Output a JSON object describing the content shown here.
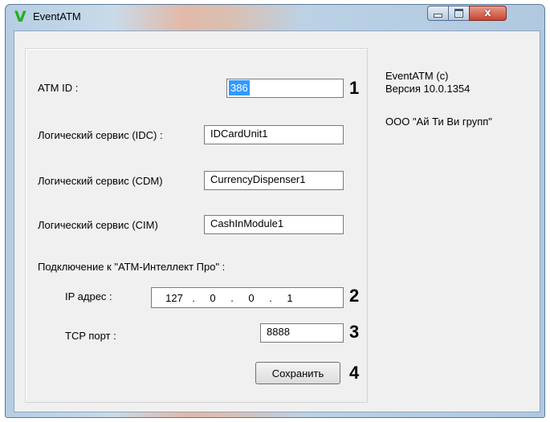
{
  "window": {
    "title": "EventATM",
    "app_icon_glyph": "V",
    "app_icon_color": "#1fb01f",
    "buttons": {
      "minimize": "minimize-icon",
      "maximize": "maximize-icon",
      "close": "close-icon",
      "close_glyph": "x"
    }
  },
  "form": {
    "atm_id_label": "ATM ID :",
    "atm_id_value": "386",
    "idc_label": "Логический сервис (IDC) :",
    "idc_value": "IDCardUnit1",
    "cdm_label": "Логический сервис (CDM)",
    "cdm_value": "CurrencyDispenser1",
    "cim_label": "Логический сервис (CIM)",
    "cim_value": "CashInModule1",
    "connection_heading": "Подключение к \"АТМ-Интеллект Про\" :",
    "ip_label": "IP адрес :",
    "ip_octets": [
      "127",
      "0",
      "0",
      "1"
    ],
    "ip_dots": [
      ".",
      ".",
      "."
    ],
    "tcp_label": "TCP порт :",
    "tcp_value": "8888",
    "save_label": "Сохранить"
  },
  "annotations": [
    "1",
    "2",
    "3",
    "4"
  ],
  "info": {
    "app_line": "EventATM (c)",
    "version_line": "Версия 10.0.1354",
    "company_line": "ООО \"Ай Ти Ви групп\""
  },
  "colors": {
    "selection": "#3399ff",
    "client_bg": "#f0f0f0"
  }
}
